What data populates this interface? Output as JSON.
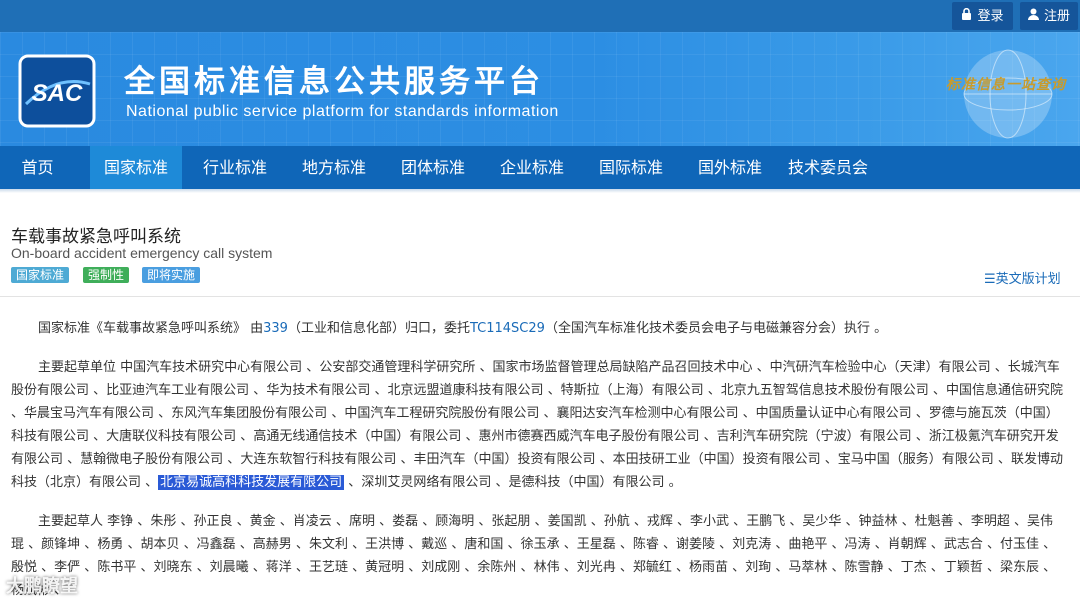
{
  "topbar": {
    "login_label": "登录",
    "register_label": "注册"
  },
  "banner": {
    "logo_text": "SAC",
    "title": "全国标准信息公共服务平台",
    "subtitle": "National public service platform  for standards information",
    "slogan": "标准信息一站查询"
  },
  "nav": {
    "items": [
      "首页",
      "国家标准",
      "行业标准",
      "地方标准",
      "团体标准",
      "企业标准",
      "国际标准",
      "国外标准",
      "技术委员会"
    ],
    "active_index": 1
  },
  "doc": {
    "title": "车载事故紧急呼叫系统",
    "subtitle": "On-board accident emergency call system",
    "badges": [
      {
        "label": "国家标准",
        "color": "#4eaad4"
      },
      {
        "label": "强制性",
        "color": "#3fae5a"
      },
      {
        "label": "即将实施",
        "color": "#4a9ee0"
      }
    ],
    "en_plan_label": "英文版计划"
  },
  "intro": {
    "prefix": "国家标准《车载事故紧急呼叫系统》 由",
    "dept_code": "339",
    "dept_text": "（工业和信息化部）归口，委托",
    "tc_code": "TC114SC29",
    "tc_text": "（全国汽车标准化技术委员会电子与电磁兼容分会）执行 。"
  },
  "drafting_units": {
    "label": "主要起草单位",
    "units": [
      "中国汽车技术研究中心有限公司",
      "公安部交通管理科学研究所",
      "国家市场监督管理总局缺陷产品召回技术中心",
      "中汽研汽车检验中心（天津）有限公司",
      "长城汽车股份有限公司",
      "比亚迪汽车工业有限公司",
      "华为技术有限公司",
      "北京远盟道康科技有限公司",
      "特斯拉（上海）有限公司",
      "北京九五智驾信息技术股份有限公司",
      "中国信息通信研究院",
      "华晨宝马汽车有限公司",
      "东风汽车集团股份有限公司",
      "中国汽车工程研究院股份有限公司",
      "襄阳达安汽车检测中心有限公司",
      "中国质量认证中心有限公司",
      "罗德与施瓦茨（中国）科技有限公司",
      "大唐联仪科技有限公司",
      "高通无线通信技术（中国）有限公司",
      "惠州市德赛西威汽车电子股份有限公司",
      "吉利汽车研究院（宁波）有限公司",
      "浙江极氪汽车研究开发有限公司",
      "慧翰微电子股份有限公司",
      "大连东软智行科技有限公司",
      "丰田汽车（中国）投资有限公司",
      "本田技研工业（中国）投资有限公司",
      "宝马中国（服务）有限公司",
      "联发博动科技（北京）有限公司"
    ],
    "highlighted_unit": "北京易诚高科科技发展有限公司",
    "after_units": [
      "深圳艾灵网络有限公司",
      "是德科技（中国）有限公司"
    ]
  },
  "drafters": {
    "label": "主要起草人",
    "names": [
      "李铮",
      "朱彤",
      "孙正良",
      "黄金",
      "肖凌云",
      "席明",
      "娄磊",
      "顾海明",
      "张起朋",
      "姜国凯",
      "孙航",
      "戎辉",
      "李小武",
      "王鹏飞",
      "吴少华",
      "钟益林",
      "杜魁善",
      "李明超",
      "吴伟琨",
      "颜锋坤",
      "杨勇",
      "胡本贝",
      "冯鑫磊",
      "高赫男",
      "朱文利",
      "王洪博",
      "戴巡",
      "唐和国",
      "徐玉承",
      "王星磊",
      "陈睿",
      "谢姜陵",
      "刘克涛",
      "曲艳平",
      "冯涛",
      "肖朝辉",
      "武志合",
      "付玉佳",
      "殷悦",
      "李俨",
      "陈书平",
      "刘晓东",
      "刘晨曦",
      "蒋洋",
      "王艺琏",
      "黄冠明",
      "刘成刚",
      "余陈州",
      "林伟",
      "刘光冉",
      "郑毓红",
      "杨雨苗",
      "刘珣",
      "马萃林",
      "陈雪静",
      "丁杰",
      "丁颖哲",
      "梁东辰",
      "杨斌彬"
    ]
  },
  "watermark": "大鹏瞭望",
  "colors": {
    "topbar": "#1f6fb6",
    "nav": "#0f66b8",
    "nav_active": "#1e8ad8",
    "link": "#1a6bb8",
    "highlight": "#2a5ad6"
  }
}
